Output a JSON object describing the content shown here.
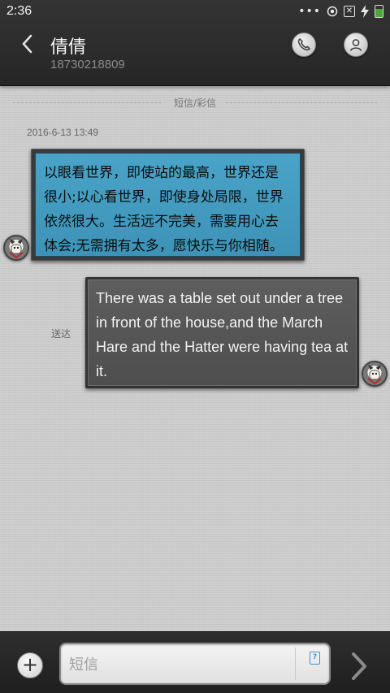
{
  "status_bar": {
    "time": "2:36",
    "icons": [
      "more-dots-icon",
      "location-icon",
      "no-sim-icon",
      "charging-icon",
      "battery-icon"
    ],
    "battery_color": "#4ca83b"
  },
  "header": {
    "contact_name": "倩倩",
    "contact_number": "18730218809",
    "icons": [
      "back-icon",
      "phone-icon",
      "profile-icon"
    ]
  },
  "conversation": {
    "type_label": "短信/彩信",
    "timestamp": "2016-6-13 13:49",
    "incoming_message": "以眼看世界，即使站的最高，世界还是很小;以心看世界，即使身处局限，世界依然很大。生活远不完美，需要用心去体会;无需拥有太多，愿快乐与你相随。",
    "outgoing_message": "There was a table set out under a tree in front of the house,and the March Hare and the Hatter were having tea at it.",
    "outgoing_status": "送达",
    "colors": {
      "incoming_bubble": "#45a0c4",
      "outgoing_bubble": "#555555",
      "background": "#cdcdcd"
    }
  },
  "compose": {
    "placeholder": "短信",
    "add_symbol": "+",
    "template_symbol": "?",
    "icons": [
      "add-icon",
      "template-icon",
      "send-icon"
    ]
  }
}
